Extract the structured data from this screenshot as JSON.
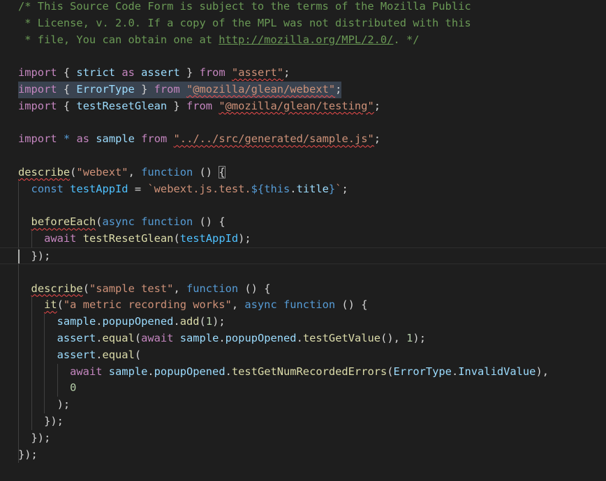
{
  "editor": {
    "language": "javascript",
    "cursor_line": 16,
    "selected_line": 6,
    "lines": [
      {
        "tokens": [
          {
            "t": "/* This Source Code Form is subject to the terms of the Mozilla Public",
            "c": "comment"
          }
        ]
      },
      {
        "tokens": [
          {
            "t": " * License, v. 2.0. If a copy of the MPL was not distributed with this",
            "c": "comment"
          }
        ]
      },
      {
        "tokens": [
          {
            "t": " * file, You can obtain one at ",
            "c": "comment"
          },
          {
            "t": "http://mozilla.org/MPL/2.0/",
            "c": "comment link"
          },
          {
            "t": ". */",
            "c": "comment"
          }
        ]
      },
      {
        "tokens": []
      },
      {
        "tokens": [
          {
            "t": "import",
            "c": "kw"
          },
          {
            "t": " { ",
            "c": "punc"
          },
          {
            "t": "strict",
            "c": "var"
          },
          {
            "t": " ",
            "c": "punc"
          },
          {
            "t": "as",
            "c": "kw"
          },
          {
            "t": " ",
            "c": "punc"
          },
          {
            "t": "assert",
            "c": "var"
          },
          {
            "t": " } ",
            "c": "punc"
          },
          {
            "t": "from",
            "c": "kw"
          },
          {
            "t": " ",
            "c": "punc"
          },
          {
            "t": "\"assert\"",
            "c": "str squiggle"
          },
          {
            "t": ";",
            "c": "punc"
          }
        ]
      },
      {
        "tokens": [
          {
            "t": "import",
            "c": "kw"
          },
          {
            "t": " { ",
            "c": "punc"
          },
          {
            "t": "ErrorType",
            "c": "var"
          },
          {
            "t": " } ",
            "c": "punc"
          },
          {
            "t": "from",
            "c": "kw"
          },
          {
            "t": " ",
            "c": "punc"
          },
          {
            "t": "\"@mozilla/glean/webext\"",
            "c": "str squiggle"
          },
          {
            "t": ";",
            "c": "punc"
          }
        ]
      },
      {
        "tokens": [
          {
            "t": "import",
            "c": "kw"
          },
          {
            "t": " { ",
            "c": "punc"
          },
          {
            "t": "testResetGlean",
            "c": "var"
          },
          {
            "t": " } ",
            "c": "punc"
          },
          {
            "t": "from",
            "c": "kw"
          },
          {
            "t": " ",
            "c": "punc"
          },
          {
            "t": "\"@mozilla/glean/testing\"",
            "c": "str squiggle"
          },
          {
            "t": ";",
            "c": "punc"
          }
        ]
      },
      {
        "tokens": []
      },
      {
        "tokens": [
          {
            "t": "import",
            "c": "kw"
          },
          {
            "t": " ",
            "c": "punc"
          },
          {
            "t": "*",
            "c": "storage"
          },
          {
            "t": " ",
            "c": "punc"
          },
          {
            "t": "as",
            "c": "kw"
          },
          {
            "t": " ",
            "c": "punc"
          },
          {
            "t": "sample",
            "c": "var"
          },
          {
            "t": " ",
            "c": "punc"
          },
          {
            "t": "from",
            "c": "kw"
          },
          {
            "t": " ",
            "c": "punc"
          },
          {
            "t": "\"../../src/generated/sample.js\"",
            "c": "str squiggle"
          },
          {
            "t": ";",
            "c": "punc"
          }
        ]
      },
      {
        "tokens": []
      },
      {
        "tokens": [
          {
            "t": "describe",
            "c": "fn squiggle"
          },
          {
            "t": "(",
            "c": "punc"
          },
          {
            "t": "\"webext\"",
            "c": "str"
          },
          {
            "t": ", ",
            "c": "punc"
          },
          {
            "t": "function",
            "c": "storage"
          },
          {
            "t": " () ",
            "c": "punc"
          },
          {
            "t": "{",
            "c": "punc bracket-match"
          }
        ]
      },
      {
        "tokens": [
          {
            "t": "  ",
            "c": "punc"
          },
          {
            "t": "const",
            "c": "storage"
          },
          {
            "t": " ",
            "c": "punc"
          },
          {
            "t": "testAppId",
            "c": "const"
          },
          {
            "t": " = ",
            "c": "punc"
          },
          {
            "t": "`webext.js.test.",
            "c": "str"
          },
          {
            "t": "${",
            "c": "tpl"
          },
          {
            "t": "this",
            "c": "storage"
          },
          {
            "t": ".",
            "c": "punc"
          },
          {
            "t": "title",
            "c": "var"
          },
          {
            "t": "}",
            "c": "tpl"
          },
          {
            "t": "`",
            "c": "str"
          },
          {
            "t": ";",
            "c": "punc"
          }
        ]
      },
      {
        "tokens": []
      },
      {
        "tokens": [
          {
            "t": "  ",
            "c": "punc"
          },
          {
            "t": "beforeEach",
            "c": "fn squiggle"
          },
          {
            "t": "(",
            "c": "punc"
          },
          {
            "t": "async",
            "c": "storage"
          },
          {
            "t": " ",
            "c": "punc"
          },
          {
            "t": "function",
            "c": "storage"
          },
          {
            "t": " () {",
            "c": "punc"
          }
        ]
      },
      {
        "tokens": [
          {
            "t": "    ",
            "c": "punc"
          },
          {
            "t": "await",
            "c": "kw"
          },
          {
            "t": " ",
            "c": "punc"
          },
          {
            "t": "testResetGlean",
            "c": "fn"
          },
          {
            "t": "(",
            "c": "punc"
          },
          {
            "t": "testAppId",
            "c": "const"
          },
          {
            "t": ");",
            "c": "punc"
          }
        ]
      },
      {
        "tokens": [
          {
            "t": "  });",
            "c": "punc"
          }
        ]
      },
      {
        "tokens": []
      },
      {
        "tokens": [
          {
            "t": "  ",
            "c": "punc"
          },
          {
            "t": "describe",
            "c": "fn squiggle"
          },
          {
            "t": "(",
            "c": "punc"
          },
          {
            "t": "\"sample test\"",
            "c": "str"
          },
          {
            "t": ", ",
            "c": "punc"
          },
          {
            "t": "function",
            "c": "storage"
          },
          {
            "t": " () {",
            "c": "punc"
          }
        ]
      },
      {
        "tokens": [
          {
            "t": "    ",
            "c": "punc"
          },
          {
            "t": "it",
            "c": "fn squiggle"
          },
          {
            "t": "(",
            "c": "punc"
          },
          {
            "t": "\"a metric recording works\"",
            "c": "str"
          },
          {
            "t": ", ",
            "c": "punc"
          },
          {
            "t": "async",
            "c": "storage"
          },
          {
            "t": " ",
            "c": "punc"
          },
          {
            "t": "function",
            "c": "storage"
          },
          {
            "t": " () {",
            "c": "punc"
          }
        ]
      },
      {
        "tokens": [
          {
            "t": "      ",
            "c": "punc"
          },
          {
            "t": "sample",
            "c": "var"
          },
          {
            "t": ".",
            "c": "punc"
          },
          {
            "t": "popupOpened",
            "c": "var"
          },
          {
            "t": ".",
            "c": "punc"
          },
          {
            "t": "add",
            "c": "fn"
          },
          {
            "t": "(",
            "c": "punc"
          },
          {
            "t": "1",
            "c": "num"
          },
          {
            "t": ");",
            "c": "punc"
          }
        ]
      },
      {
        "tokens": [
          {
            "t": "      ",
            "c": "punc"
          },
          {
            "t": "assert",
            "c": "var"
          },
          {
            "t": ".",
            "c": "punc"
          },
          {
            "t": "equal",
            "c": "fn"
          },
          {
            "t": "(",
            "c": "punc"
          },
          {
            "t": "await",
            "c": "kw"
          },
          {
            "t": " ",
            "c": "punc"
          },
          {
            "t": "sample",
            "c": "var"
          },
          {
            "t": ".",
            "c": "punc"
          },
          {
            "t": "popupOpened",
            "c": "var"
          },
          {
            "t": ".",
            "c": "punc"
          },
          {
            "t": "testGetValue",
            "c": "fn"
          },
          {
            "t": "(), ",
            "c": "punc"
          },
          {
            "t": "1",
            "c": "num"
          },
          {
            "t": ");",
            "c": "punc"
          }
        ]
      },
      {
        "tokens": [
          {
            "t": "      ",
            "c": "punc"
          },
          {
            "t": "assert",
            "c": "var"
          },
          {
            "t": ".",
            "c": "punc"
          },
          {
            "t": "equal",
            "c": "fn"
          },
          {
            "t": "(",
            "c": "punc"
          }
        ]
      },
      {
        "tokens": [
          {
            "t": "        ",
            "c": "punc"
          },
          {
            "t": "await",
            "c": "kw"
          },
          {
            "t": " ",
            "c": "punc"
          },
          {
            "t": "sample",
            "c": "var"
          },
          {
            "t": ".",
            "c": "punc"
          },
          {
            "t": "popupOpened",
            "c": "var"
          },
          {
            "t": ".",
            "c": "punc"
          },
          {
            "t": "testGetNumRecordedErrors",
            "c": "fn"
          },
          {
            "t": "(",
            "c": "punc"
          },
          {
            "t": "ErrorType",
            "c": "var"
          },
          {
            "t": ".",
            "c": "punc"
          },
          {
            "t": "InvalidValue",
            "c": "var"
          },
          {
            "t": "),",
            "c": "punc"
          }
        ]
      },
      {
        "tokens": [
          {
            "t": "        ",
            "c": "punc"
          },
          {
            "t": "0",
            "c": "num"
          }
        ]
      },
      {
        "tokens": [
          {
            "t": "      );",
            "c": "punc"
          }
        ]
      },
      {
        "tokens": [
          {
            "t": "    });",
            "c": "punc"
          }
        ]
      },
      {
        "tokens": [
          {
            "t": "  });",
            "c": "punc"
          }
        ]
      },
      {
        "tokens": [
          {
            "t": "});",
            "c": "punc"
          }
        ]
      }
    ]
  }
}
